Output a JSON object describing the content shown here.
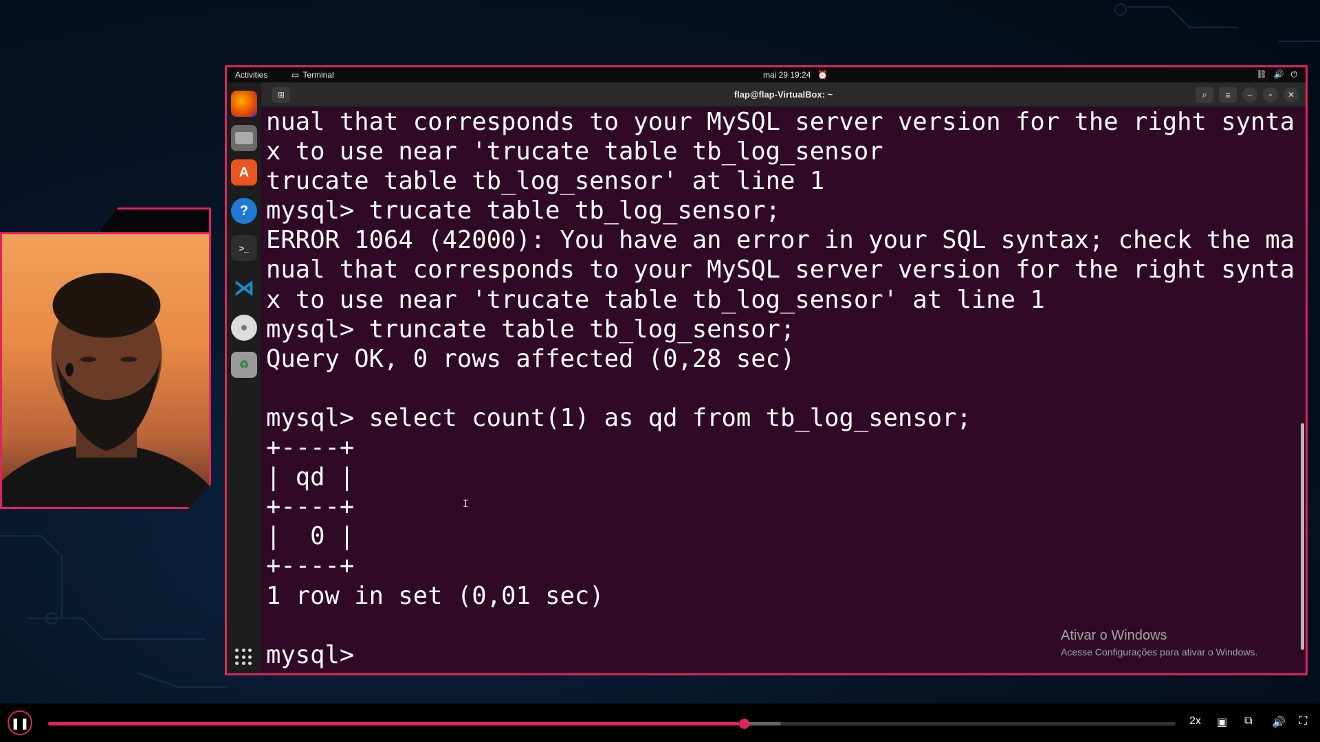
{
  "topbar": {
    "activities": "Activities",
    "app_name": "Terminal",
    "clock": "mai 29  19:24"
  },
  "terminal": {
    "title": "flap@flap-VirtualBox: ~",
    "lines": [
      "nual that corresponds to your MySQL server version for the right synta",
      "x to use near 'trucate table tb_log_sensor",
      "trucate table tb_log_sensor' at line 1",
      "mysql> trucate table tb_log_sensor;",
      "ERROR 1064 (42000): You have an error in your SQL syntax; check the ma",
      "nual that corresponds to your MySQL server version for the right synta",
      "x to use near 'trucate table tb_log_sensor' at line 1",
      "mysql> truncate table tb_log_sensor;",
      "Query OK, 0 rows affected (0,28 sec)",
      "",
      "mysql> select count(1) as qd from tb_log_sensor;",
      "+----+",
      "| qd |",
      "+----+",
      "|  0 |",
      "+----+",
      "1 row in set (0,01 sec)",
      "",
      "mysql> "
    ]
  },
  "watermark": {
    "title": "Ativar o Windows",
    "subtitle": "Acesse Configurações para ativar o Windows."
  },
  "dock": {
    "items": [
      "firefox-icon",
      "files-icon",
      "app-center-icon",
      "help-icon",
      "terminal-icon",
      "vscode-icon",
      "disc-icon",
      "trash-icon"
    ]
  },
  "player": {
    "speed": "2x",
    "progress": 0.617,
    "buffered": 0.65,
    "accent": "#e0245e"
  }
}
